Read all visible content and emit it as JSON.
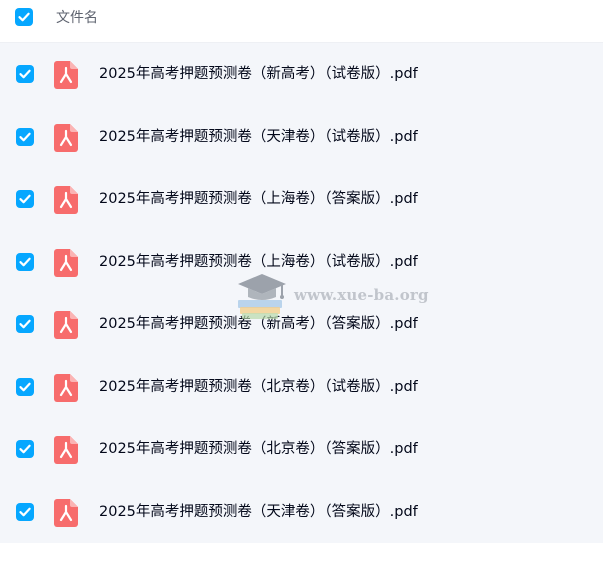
{
  "header": {
    "select_all_checked": true,
    "column_title": "文件名"
  },
  "files": [
    {
      "name": "2025年高考押题预测卷（新高考）（试卷版）.pdf",
      "checked": true,
      "icon": "pdf-icon"
    },
    {
      "name": "2025年高考押题预测卷（天津卷）（试卷版）.pdf",
      "checked": true,
      "icon": "pdf-icon"
    },
    {
      "name": "2025年高考押题预测卷（上海卷）（答案版）.pdf",
      "checked": true,
      "icon": "pdf-icon"
    },
    {
      "name": "2025年高考押题预测卷（上海卷）（试卷版）.pdf",
      "checked": true,
      "icon": "pdf-icon"
    },
    {
      "name": "2025年高考押题预测卷（新高考）（答案版）.pdf",
      "checked": true,
      "icon": "pdf-icon"
    },
    {
      "name": "2025年高考押题预测卷（北京卷）（试卷版）.pdf",
      "checked": true,
      "icon": "pdf-icon"
    },
    {
      "name": "2025年高考押题预测卷（北京卷）（答案版）.pdf",
      "checked": true,
      "icon": "pdf-icon"
    },
    {
      "name": "2025年高考押题预测卷（天津卷）（答案版）.pdf",
      "checked": true,
      "icon": "pdf-icon"
    }
  ],
  "watermark": {
    "text": "www.xue-ba.org",
    "icon": "graduation-cap-icon"
  },
  "colors": {
    "checkbox": "#06a7ff",
    "pdf_icon": "#f76c6c",
    "list_background": "#f4f6fa",
    "text": "#03081a"
  }
}
